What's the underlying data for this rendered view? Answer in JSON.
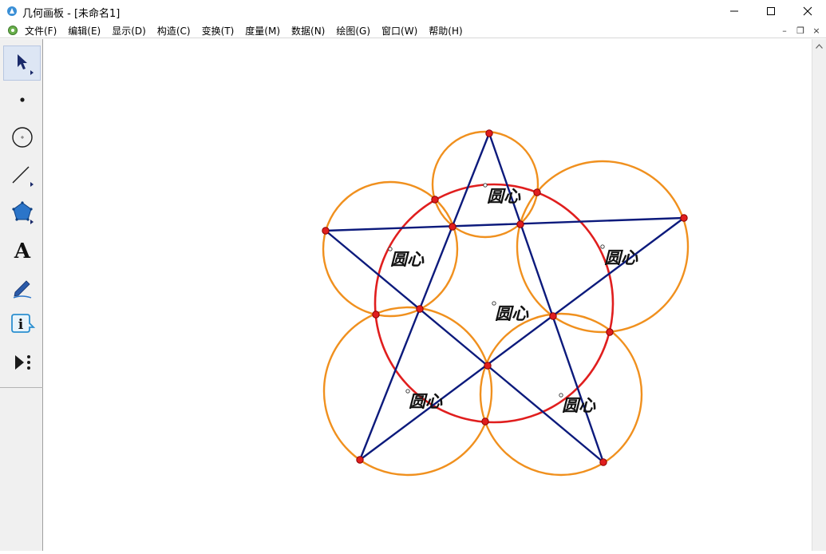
{
  "window": {
    "title": "几何画板 - [未命名1]",
    "controls": {
      "minimize": "—",
      "maximize": "☐",
      "close": "✕"
    }
  },
  "menu": {
    "items": [
      {
        "label": "文件(F)"
      },
      {
        "label": "编辑(E)"
      },
      {
        "label": "显示(D)"
      },
      {
        "label": "构造(C)"
      },
      {
        "label": "变换(T)"
      },
      {
        "label": "度量(M)"
      },
      {
        "label": "数据(N)"
      },
      {
        "label": "绘图(G)"
      },
      {
        "label": "窗口(W)"
      },
      {
        "label": "帮助(H)"
      }
    ],
    "mdi": {
      "minimize": "–",
      "restore": "❐",
      "close": "×"
    }
  },
  "toolbox": {
    "tools": [
      {
        "name": "arrow-tool-icon"
      },
      {
        "name": "point-tool-icon"
      },
      {
        "name": "compass-tool-icon"
      },
      {
        "name": "straightedge-tool-icon"
      },
      {
        "name": "polygon-tool-icon"
      },
      {
        "name": "text-tool-icon",
        "glyph": "A"
      },
      {
        "name": "marker-tool-icon"
      },
      {
        "name": "information-tool-icon",
        "glyph": "i"
      },
      {
        "name": "custom-tool-icon"
      }
    ]
  },
  "drawing": {
    "colors": {
      "circle_main": "#e01e1e",
      "circle_small": "#f0901e",
      "line": "#0c1a7c",
      "point": "#e01e1e",
      "point_stroke": "#8a0000"
    },
    "labels": [
      {
        "text": "圆心"
      },
      {
        "text": "圆心"
      },
      {
        "text": "圆心"
      },
      {
        "text": "圆心"
      },
      {
        "text": "圆心"
      },
      {
        "text": "圆心"
      }
    ]
  }
}
